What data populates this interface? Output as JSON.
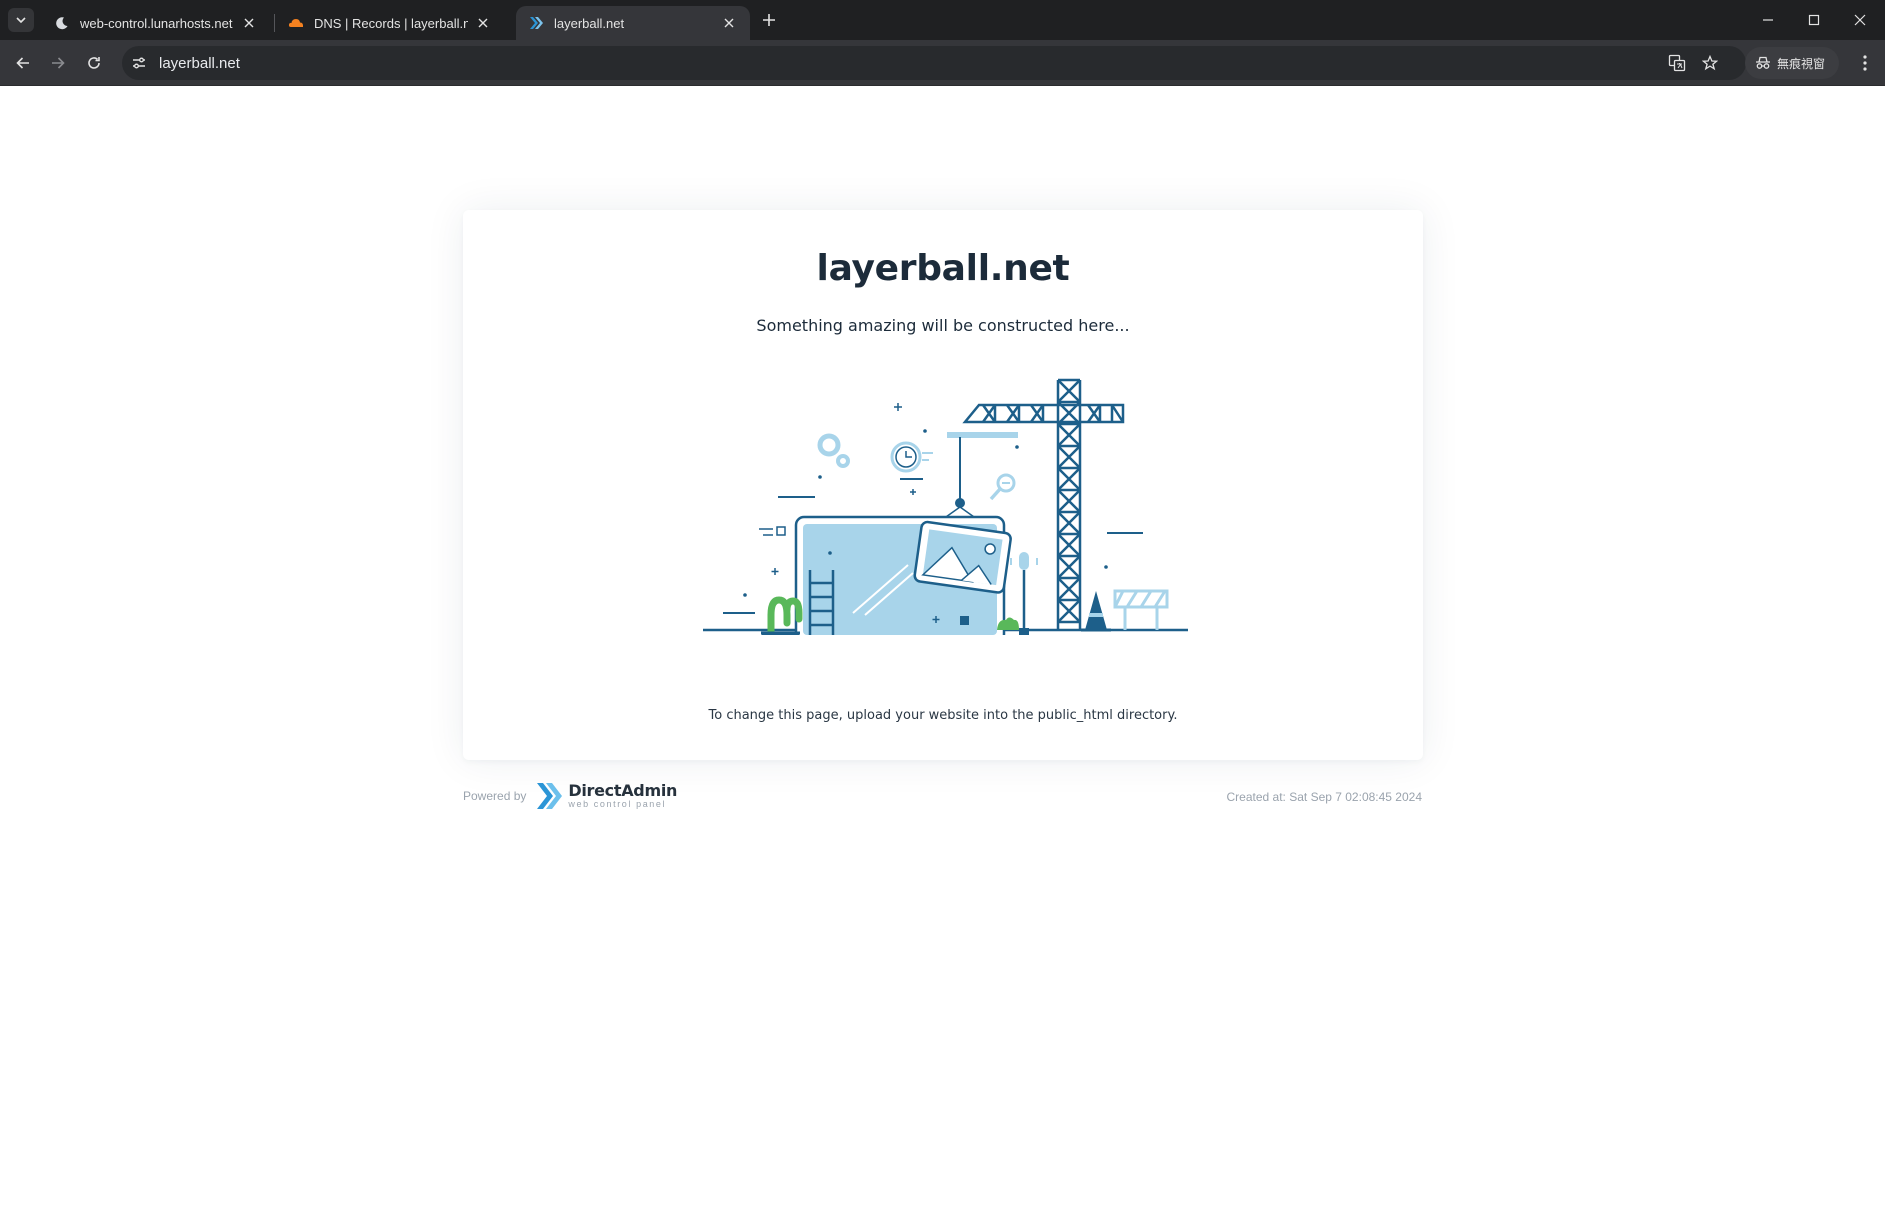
{
  "browser": {
    "tabs": [
      {
        "title": "web-control.lunarhosts.net | D",
        "icon": "crescent-moon-icon",
        "active": false
      },
      {
        "title": "DNS | Records | layerball.net |",
        "icon": "cloudflare-cloud-icon",
        "active": false
      },
      {
        "title": "layerball.net",
        "icon": "directadmin-icon",
        "active": true
      }
    ],
    "url": "layerball.net",
    "profile_label": "無痕視窗",
    "icons": {
      "back": "arrow-left-icon",
      "forward": "arrow-right-icon",
      "reload": "reload-icon",
      "site_info": "tune-icon",
      "translate": "translate-icon",
      "bookmark": "star-icon",
      "incognito": "incognito-icon",
      "menu": "kebab-menu-icon"
    }
  },
  "page": {
    "title": "layerball.net",
    "subtitle": "Something amazing will be constructed here...",
    "hint": "To change this page, upload your website into the public_html directory.",
    "powered_by": "Powered by",
    "brand_name": "DirectAdmin",
    "brand_tagline": "web control panel",
    "created_at": "Created at: Sat Sep 7 02:08:45 2024",
    "illustration": "under-construction-illustration"
  },
  "colors": {
    "chrome_dark": "#1f2022",
    "toolbar": "#35363a",
    "heading": "#1c2b3a",
    "illustration_primary": "#1d5f8a",
    "illustration_light": "#a8d4ea",
    "brand_blue": "#2b95d6",
    "cactus_green": "#59b85a"
  }
}
